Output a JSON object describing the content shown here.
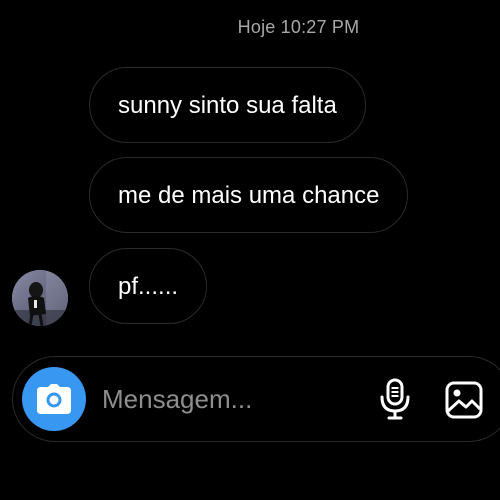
{
  "chat": {
    "timestamp": "Hoje 10:27 PM",
    "messages": [
      {
        "text": "sunny sinto sua falta"
      },
      {
        "text": "me de mais uma chance"
      },
      {
        "text": "pf......"
      }
    ]
  },
  "composer": {
    "placeholder": "Mensagem...",
    "camera_icon": "camera-icon",
    "mic_icon": "microphone-icon",
    "gallery_icon": "image-gallery-icon",
    "accent_color": "#3897f0"
  },
  "avatar": {
    "icon": "avatar-photo"
  }
}
